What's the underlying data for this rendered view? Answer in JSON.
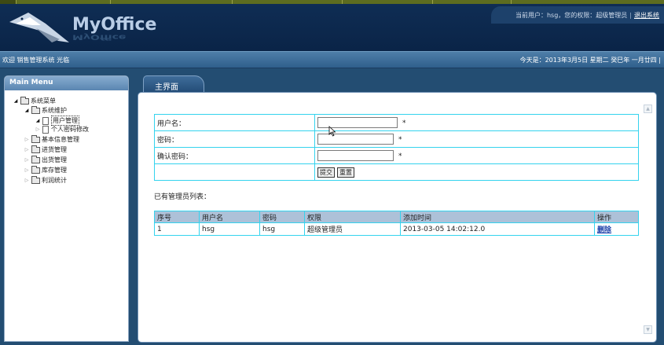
{
  "header": {
    "logo_text": "MyOffice",
    "user_label": "当前用户：hsg，您的权限：超级管理员",
    "logout_label": "退出系统"
  },
  "welcome_bar": {
    "welcome_text": "欢迎 销售管理系统 光临",
    "date_text": "今天是：2013年3月5日 星期二 癸巳年 一月廿四 |"
  },
  "sidebar": {
    "title": "Main Menu",
    "tree": {
      "root": "系统菜单",
      "system_maintenance": "系统维护",
      "user_management": "用户管理",
      "password_change": "个人密码修改",
      "basic_info": "基本信息管理",
      "purchase": "进货管理",
      "shipment": "出货管理",
      "inventory": "库存管理",
      "profit_stats": "利润统计"
    }
  },
  "main": {
    "tab_label": "主界面",
    "form": {
      "username_label": "用户名：",
      "password_label": "密码：",
      "confirm_label": "确认密码：",
      "required_mark": "*",
      "submit_label": "提交",
      "reset_label": "重置"
    },
    "list_label": "已有管理员列表：",
    "table": {
      "headers": [
        "序号",
        "用户名",
        "密码",
        "权限",
        "添加时间",
        "操作"
      ],
      "rows": [
        [
          "1",
          "hsg",
          "hsg",
          "超级管理员",
          "2013-03-05 14:02:12.0",
          "删除"
        ]
      ]
    }
  },
  "colors": {
    "background": "#234d72",
    "header_bg": "#0f2d54",
    "table_border": "#34d3ee",
    "table_header_bg": "#adc1d8",
    "link": "#1a3fa8"
  }
}
